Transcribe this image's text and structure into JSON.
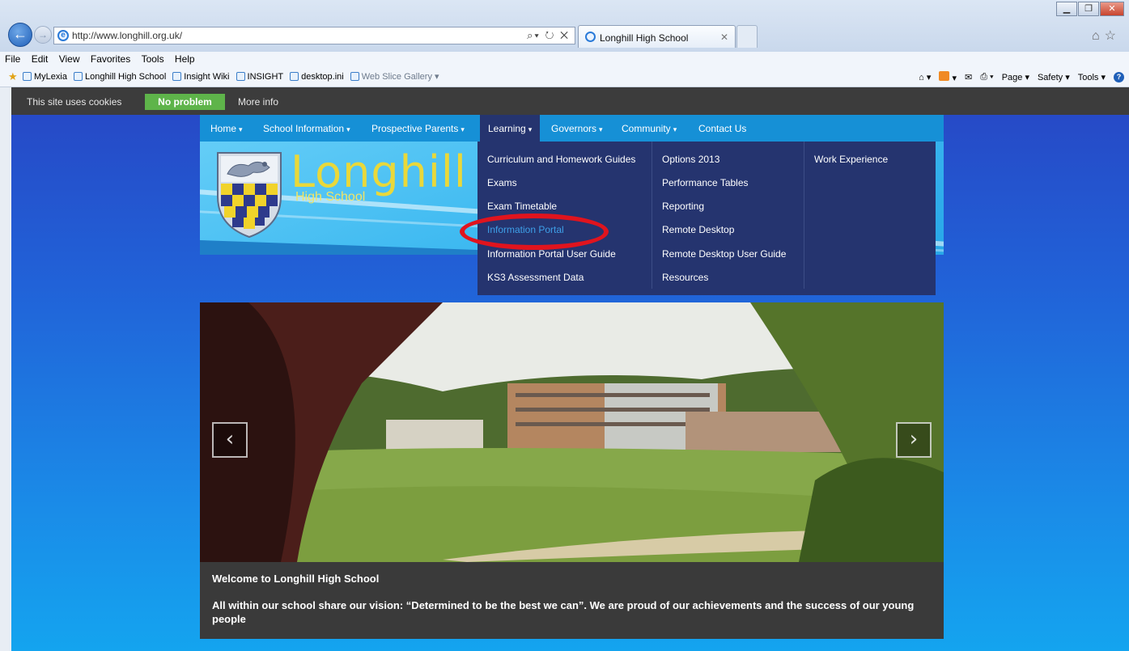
{
  "browser": {
    "url": "http://www.longhill.org.uk/",
    "tab_title": "Longhill High School",
    "menu": [
      "File",
      "Edit",
      "View",
      "Favorites",
      "Tools",
      "Help"
    ],
    "favorites": [
      "MyLexia",
      "Longhill High School",
      "Insight Wiki",
      "INSIGHT",
      "desktop.ini",
      "Web Slice Gallery"
    ],
    "commands": [
      "Page",
      "Safety",
      "Tools"
    ]
  },
  "cookie": {
    "text": "This site uses cookies",
    "accept_label": "No problem",
    "more_label": "More info"
  },
  "nav": [
    {
      "label": "Home",
      "caret": "▾"
    },
    {
      "label": "School Information",
      "caret": "▾"
    },
    {
      "label": "Prospective Parents",
      "caret": "▾"
    },
    {
      "label": "Learning",
      "caret": "▾"
    },
    {
      "label": "Governors",
      "caret": "▾"
    },
    {
      "label": "Community",
      "caret": "▾"
    },
    {
      "label": "Contact Us",
      "caret": ""
    }
  ],
  "logo": {
    "name": "Longhill",
    "sub": "High School"
  },
  "dropdown": {
    "col1": [
      "Curriculum and Homework Guides",
      "Exams",
      "Exam Timetable",
      "Information Portal",
      "Information Portal User Guide",
      "KS3 Assessment Data"
    ],
    "col2": [
      "Options 2013",
      "Performance Tables",
      "Reporting",
      "Remote Desktop",
      "Remote Desktop User Guide",
      "Resources"
    ],
    "col3": [
      "Work Experience"
    ]
  },
  "hero": {
    "prev": "‹",
    "next": "›",
    "caption_title": "Welcome to Longhill High School",
    "caption_text": "All within our school share our vision: “Determined to be the best we can”. We are proud of our achievements and the success of our young people"
  },
  "colors": {
    "nav_blue": "#1690d6",
    "dropdown_navy": "#25346f",
    "accept_green": "#5eb44a",
    "highlight_red": "#e0141e"
  }
}
